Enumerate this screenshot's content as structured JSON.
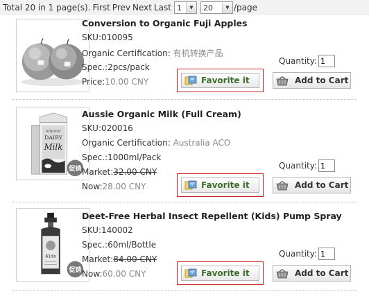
{
  "pager": {
    "summary": "Total 20 in 1 page(s).",
    "first": "First",
    "prev": "Prev",
    "next": "Next",
    "last": "Last",
    "page_value": "1",
    "per_page_value": "20",
    "per_page_suffix": "/page"
  },
  "products": [
    {
      "name": "Conversion to Organic Fuji Apples",
      "sku": "SKU:010095",
      "cert_label": "Organic Certification:",
      "cert_value": "有机转换产品",
      "spec": "Spec.:2pcs/pack",
      "price_label": "Price:",
      "price_value": "10.00 CNY",
      "quantity_label": "Quantity:",
      "quantity_value": "1",
      "favorite_label": "Favorite it",
      "cart_label": "Add to Cart",
      "image": "apples"
    },
    {
      "name": "Aussie Organic Milk (Full Cream)",
      "sku": "SKU:020016",
      "cert_label": "Organic Certification:",
      "cert_value": "Australia ACO",
      "spec": "Spec.:1000ml/Pack",
      "market_label": "Market:",
      "market_value": "32.00 CNY",
      "now_label": "Now:",
      "now_value": "28.00 CNY",
      "quantity_label": "Quantity:",
      "quantity_value": "1",
      "favorite_label": "Favorite it",
      "cart_label": "Add to Cart",
      "image": "milk-carton",
      "image_text": [
        "organic",
        "DAIRY",
        "Milk"
      ],
      "promo_badge": "促销"
    },
    {
      "name": "Deet-Free Herbal Insect Repellent (Kids) Pump Spray",
      "sku": "SKU:140002",
      "spec": "Spec.:60ml/Bottle",
      "market_label": "Market:",
      "market_value": "84.00 CNY",
      "now_label": "Now:",
      "now_value": "60.00 CNY",
      "quantity_label": "Quantity:",
      "quantity_value": "1",
      "favorite_label": "Favorite it",
      "cart_label": "Add to Cart",
      "image": "spray-bottle",
      "image_text": [
        "Kids"
      ],
      "promo_badge": "促销"
    }
  ],
  "icons": {
    "favorite": "favorite-icon",
    "cart": "shopping-basket-icon",
    "dropdown": "chevron-down-icon"
  },
  "colors": {
    "highlight_border": "#cc2222",
    "favorite_text": "#3b6e2b",
    "muted_text": "#8a8a8a"
  }
}
